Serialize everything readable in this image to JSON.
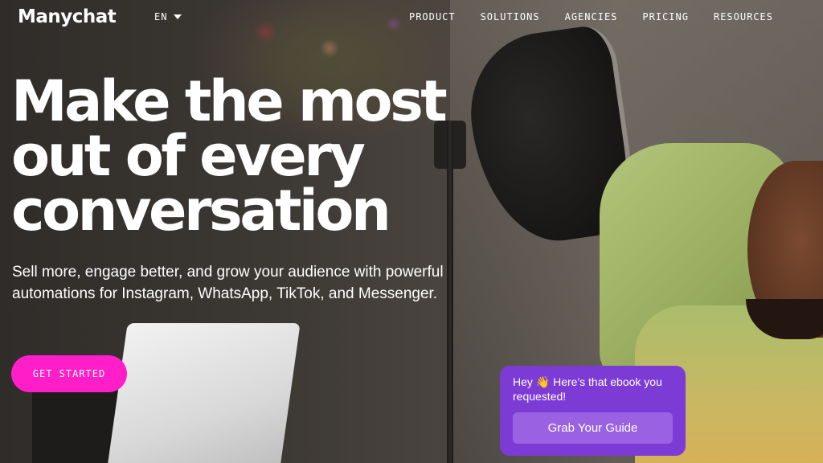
{
  "header": {
    "logo_text": "Manychat",
    "language": "EN",
    "nav": [
      {
        "label": "PRODUCT"
      },
      {
        "label": "SOLUTIONS"
      },
      {
        "label": "AGENCIES"
      },
      {
        "label": "PRICING"
      },
      {
        "label": "RESOURCES"
      }
    ]
  },
  "hero": {
    "headline_lines": [
      "Make the most",
      "out of every",
      "conversation"
    ],
    "subhead": "Sell more, engage better, and grow your audience with powerful automations for Instagram, WhatsApp, TikTok, and Messenger.",
    "cta_label": "GET STARTED"
  },
  "chat_widget": {
    "message": "Hey 👋  Here's that ebook you requested!",
    "button_label": "Grab Your Guide"
  },
  "colors": {
    "cta": "#ff1ec8",
    "chat_bg": "#7d3bd6",
    "chat_button": "#9a62e3"
  },
  "icons": {
    "language_dropdown": "chevron-down-icon"
  }
}
